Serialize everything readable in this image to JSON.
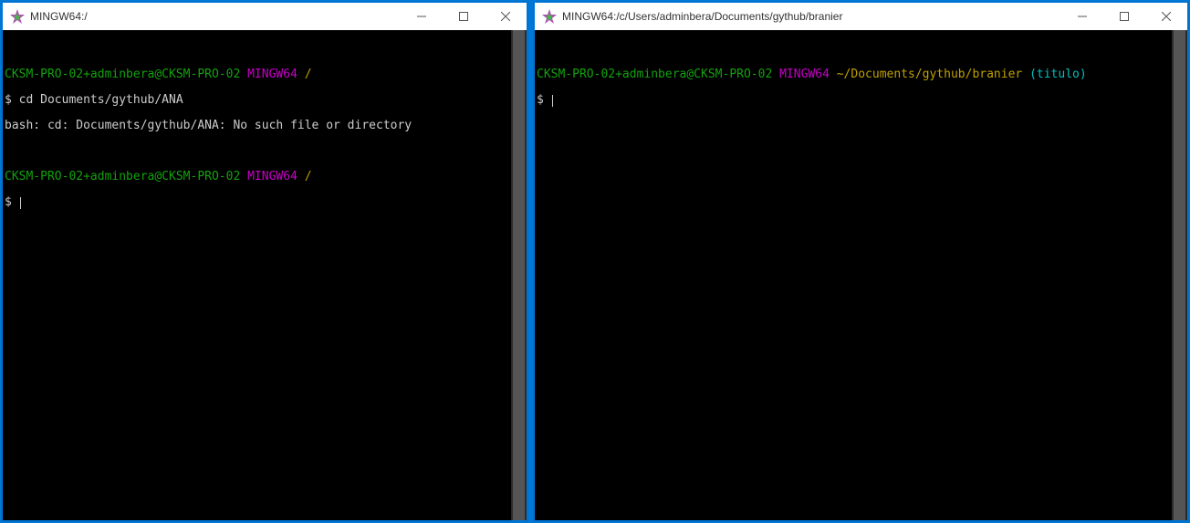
{
  "windows": {
    "left": {
      "title": "MINGW64:/",
      "prompt1": {
        "userhost": "CKSM-PRO-02+adminbera@CKSM-PRO-02",
        "env": "MINGW64",
        "path": "/"
      },
      "cmd1": "$ cd Documents/gythub/ANA",
      "err1": "bash: cd: Documents/gythub/ANA: No such file or directory",
      "prompt2": {
        "userhost": "CKSM-PRO-02+adminbera@CKSM-PRO-02",
        "env": "MINGW64",
        "path": "/"
      },
      "cmd2": "$ "
    },
    "right": {
      "title": "MINGW64:/c/Users/adminbera/Documents/gythub/branier",
      "prompt1": {
        "userhost": "CKSM-PRO-02+adminbera@CKSM-PRO-02",
        "env": "MINGW64",
        "path": "~/Documents/gythub/branier",
        "branch": "(titulo)"
      },
      "cmd1": "$ "
    }
  }
}
